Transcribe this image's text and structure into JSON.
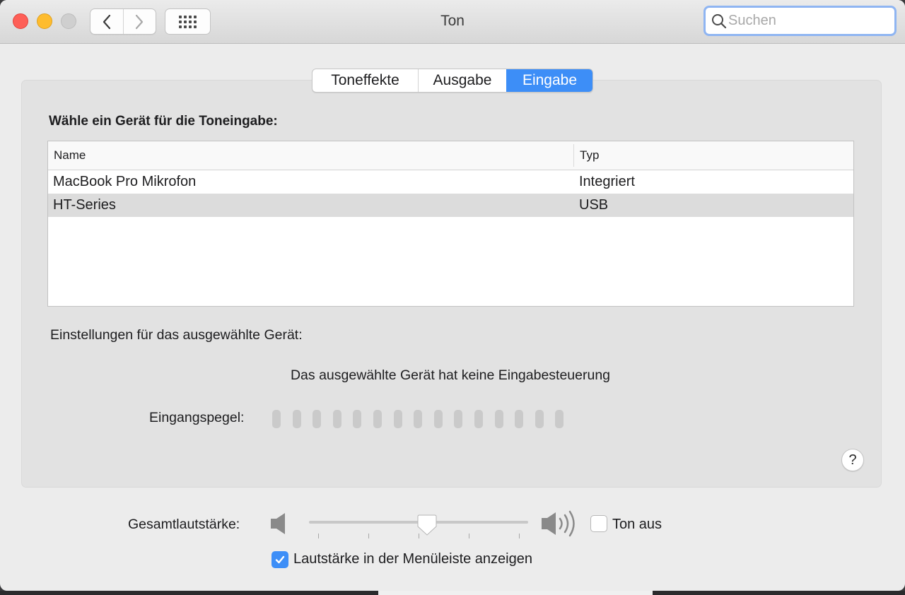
{
  "window": {
    "title": "Ton",
    "search_placeholder": "Suchen"
  },
  "tabs": [
    {
      "label": "Toneffekte",
      "active": false
    },
    {
      "label": "Ausgabe",
      "active": false
    },
    {
      "label": "Eingabe",
      "active": true
    }
  ],
  "input": {
    "choose_label": "Wähle ein Gerät für die Toneingabe:",
    "columns": {
      "name": "Name",
      "type": "Typ"
    },
    "devices": [
      {
        "name": "MacBook Pro Mikrofon",
        "type": "Integriert",
        "selected": false
      },
      {
        "name": "HT-Series",
        "type": "USB",
        "selected": true
      }
    ],
    "settings_label": "Einstellungen für das ausgewählte Gerät:",
    "no_control_message": "Das ausgewählte Gerät hat keine Eingabesteuerung",
    "level_label": "Eingangspegel:",
    "level_segments": 15,
    "level_active": 0,
    "help": "?"
  },
  "volume": {
    "label": "Gesamtlautstärke:",
    "level": 0.54,
    "mute_label": "Ton aus",
    "mute_checked": false,
    "show_in_menubar_label": "Lautstärke in der Menüleiste anzeigen",
    "show_in_menubar_checked": true
  },
  "colors": {
    "accent": "#3d8ef7",
    "close": "#fe5f57",
    "minimize": "#febc2e",
    "zoom_disabled": "#cfcfcf"
  },
  "icons": [
    "back-chevron-icon",
    "forward-chevron-icon",
    "grid-icon",
    "search-icon",
    "speaker-low-icon",
    "speaker-high-icon",
    "checkmark-icon"
  ]
}
